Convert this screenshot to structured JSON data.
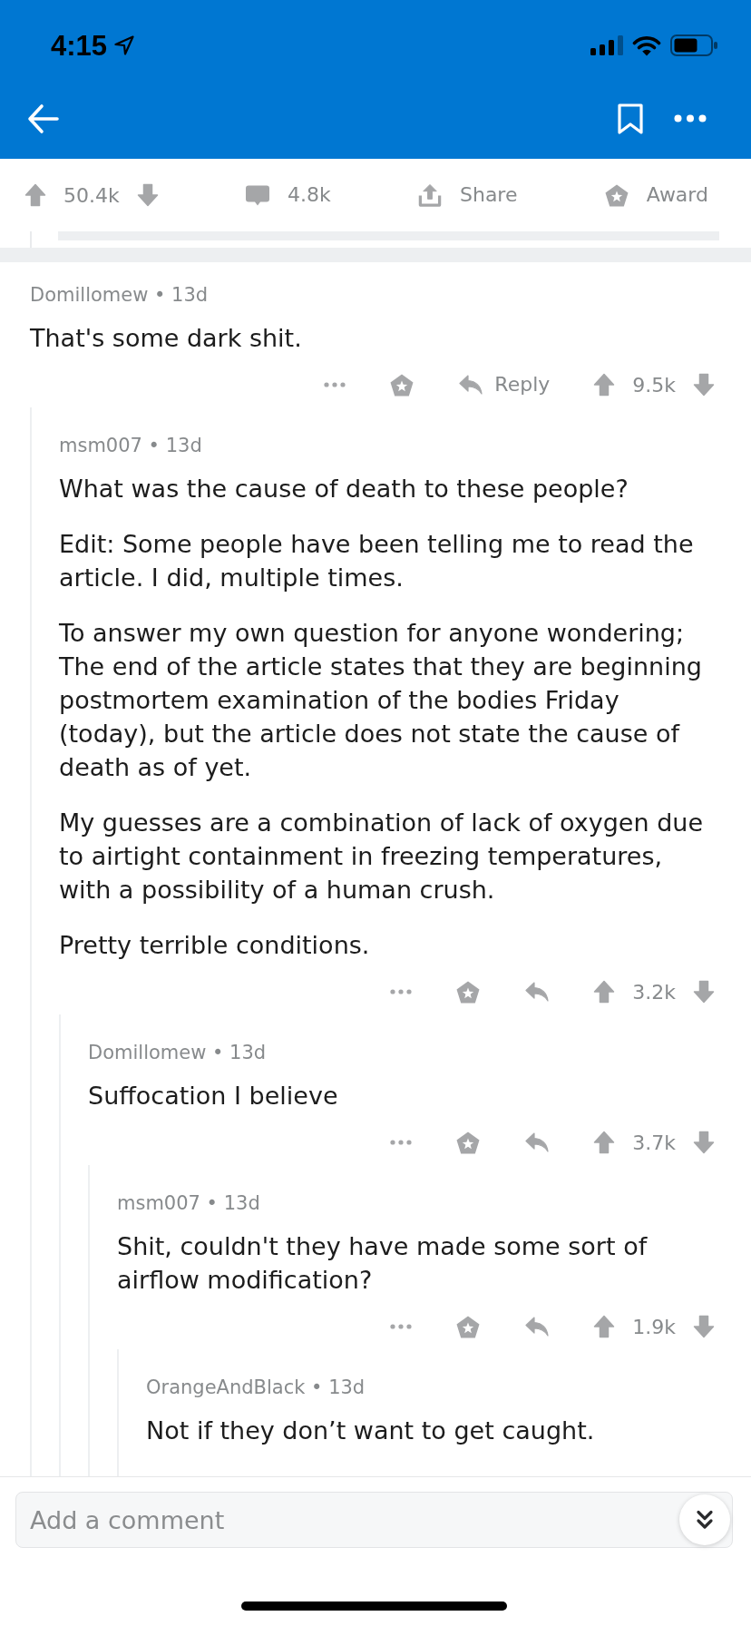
{
  "status_bar": {
    "time": "4:15"
  },
  "post_actions": {
    "score": "50.4k",
    "comments": "4.8k",
    "share": "Share",
    "award": "Award"
  },
  "comments": [
    {
      "byline": "Domillomew • 13d",
      "paragraphs": [
        "That's some dark shit."
      ],
      "reply_label": "Reply",
      "score": "9.5k",
      "children": [
        {
          "byline": "msm007 • 13d",
          "paragraphs": [
            "What was the cause of death to these people?",
            "Edit: Some people have been telling me to read the article. I did, multiple times.",
            "To answer my own question for anyone wondering; The end of the article states that they are beginning postmortem examination of the bodies Friday (today), but the article does not state the cause of death as of yet.",
            "My guesses are a combination of lack of oxygen due to airtight containment in freezing temperatures, with a possibility of a human crush.",
            "Pretty terrible conditions."
          ],
          "score": "3.2k",
          "children": [
            {
              "byline": "Domillomew • 13d",
              "paragraphs": [
                "Suffocation I believe"
              ],
              "score": "3.7k",
              "children": [
                {
                  "byline": "msm007 • 13d",
                  "paragraphs": [
                    "Shit, couldn't they have made some sort of airflow modification?"
                  ],
                  "score": "1.9k",
                  "children": [
                    {
                      "byline": "OrangeAndBlack • 13d",
                      "paragraphs": [
                        "Not if they don’t want to get caught."
                      ]
                    }
                  ]
                }
              ]
            }
          ]
        }
      ]
    }
  ],
  "composer": {
    "placeholder": "Add a comment"
  }
}
